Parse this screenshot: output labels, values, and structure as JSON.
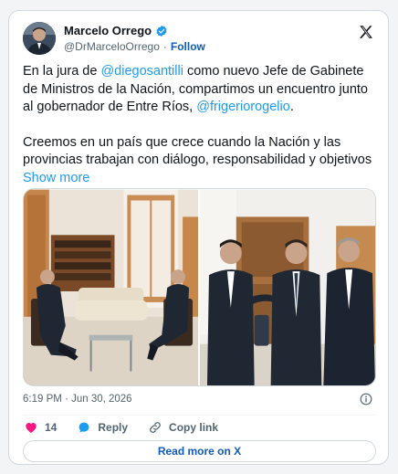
{
  "author": {
    "name": "Marcelo Orrego",
    "handle": "@DrMarceloOrrego",
    "separator": "·",
    "follow_label": "Follow"
  },
  "tweet": {
    "p1_a": "En la jura de ",
    "mention1": "@diegosantilli",
    "p1_b": " como nuevo Jefe de Gabinete de Ministros de la Nación, compartimos un encuentro junto al gobernador de Entre Ríos, ",
    "mention2": "@frigeriorogelio",
    "p1_c": ".",
    "p2": "Creemos en un país que crece cuando la Nación y las provincias trabajan con diálogo, responsabilidad y objetivos ",
    "show_more": "Show more"
  },
  "meta": {
    "time": "6:19 PM",
    "separator": "·",
    "date": "Jun 30, 2026"
  },
  "actions": {
    "likes": "14",
    "reply_label": "Reply",
    "copy_link_label": "Copy link"
  },
  "read_more_label": "Read more on X",
  "icons": [
    "verified-icon",
    "x-logo-icon",
    "info-icon",
    "heart-icon",
    "reply-icon",
    "link-icon"
  ],
  "colors": {
    "accent": "#1d9bf0",
    "link_dark": "#0f5cb8",
    "heart": "#f91880",
    "muted": "#536471",
    "border": "#cfd9de"
  }
}
